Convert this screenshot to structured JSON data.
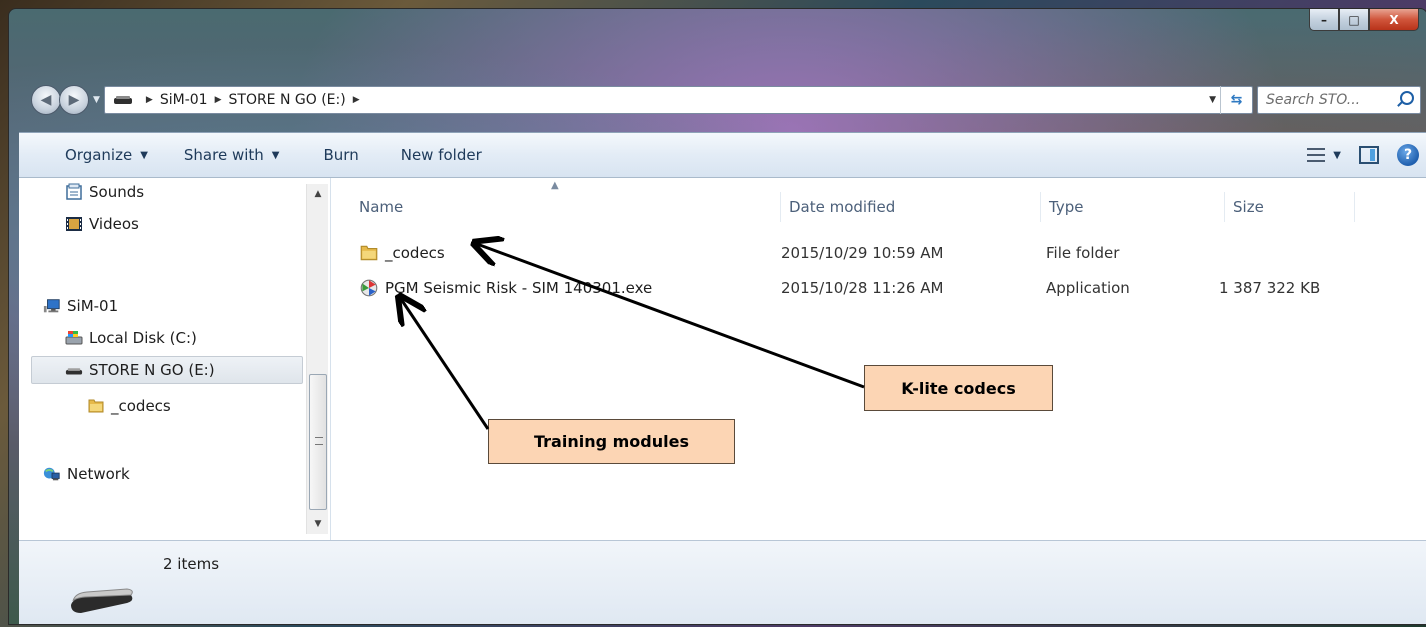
{
  "window": {
    "caption_min": "–",
    "caption_max": "□",
    "caption_close": "X"
  },
  "address": {
    "crumbs": [
      "SiM-01",
      "STORE N GO (E:)"
    ],
    "search_placeholder": "Search STO...",
    "refresh_glyph": "⇆"
  },
  "toolbar": {
    "organize": "Organize",
    "share_with": "Share with",
    "burn": "Burn",
    "new_folder": "New folder",
    "dropdown_glyph": "▼"
  },
  "nav": {
    "items": [
      {
        "label": "Sounds",
        "icon": "sounds-library-icon"
      },
      {
        "label": "Videos",
        "icon": "videos-library-icon"
      },
      {
        "label": "SiM-01",
        "icon": "computer-icon"
      },
      {
        "label": "Local Disk (C:)",
        "icon": "local-disk-icon"
      },
      {
        "label": "STORE N GO (E:)",
        "icon": "removable-drive-icon",
        "selected": true
      },
      {
        "label": "_codecs",
        "icon": "folder-icon"
      },
      {
        "label": "Network",
        "icon": "network-icon"
      }
    ]
  },
  "columns": [
    "Name",
    "Date modified",
    "Type",
    "Size"
  ],
  "files": [
    {
      "name": "_codecs",
      "date": "2015/10/29 10:59 AM",
      "type": "File folder",
      "size": "",
      "icon": "folder-icon"
    },
    {
      "name": "PGM Seismic Risk - SIM 140301.exe",
      "date": "2015/10/28 11:26 AM",
      "type": "Application",
      "size": "1 387 322 KB",
      "icon": "application-icon"
    }
  ],
  "annotations": {
    "codecs": "K-lite codecs",
    "training": "Training modules"
  },
  "details": {
    "item_count": "2 items"
  },
  "colors": {
    "callout_fill": "#fcd5b4",
    "toolbar_text": "#1e3a5a",
    "header_text": "#4c607a"
  }
}
